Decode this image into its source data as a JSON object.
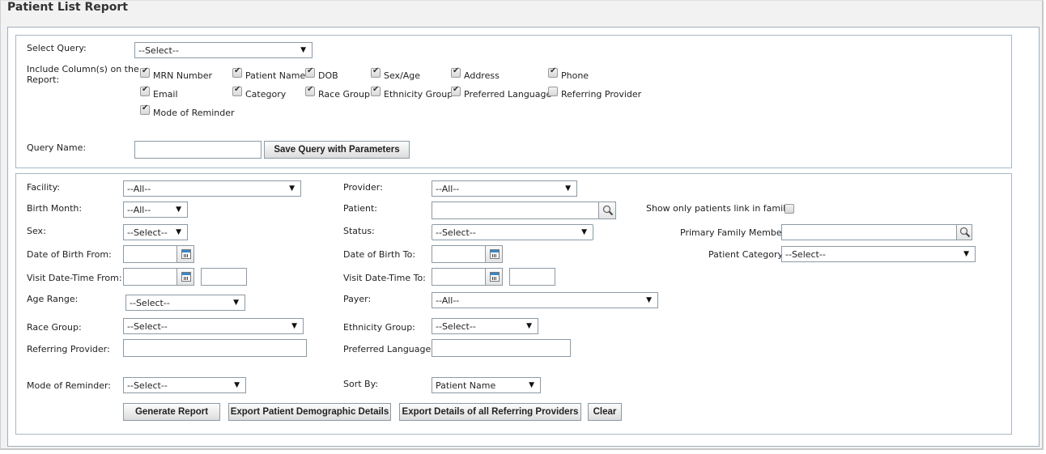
{
  "page": {
    "title": "Patient List Report"
  },
  "query": {
    "select_query_label": "Select Query:",
    "select_query_value": "--Select--",
    "include_columns_label_line1": "Include Column(s) on the",
    "include_columns_label_line2": "Report:",
    "columns": [
      {
        "label": "MRN Number",
        "checked": true
      },
      {
        "label": "Patient Name",
        "checked": true
      },
      {
        "label": "DOB",
        "checked": true
      },
      {
        "label": "Sex/Age",
        "checked": true
      },
      {
        "label": "Address",
        "checked": true
      },
      {
        "label": "Phone",
        "checked": true
      },
      {
        "label": "Email",
        "checked": true
      },
      {
        "label": "Category",
        "checked": true
      },
      {
        "label": "Race Group",
        "checked": true
      },
      {
        "label": "Ethnicity Group",
        "checked": true
      },
      {
        "label": "Preferred Language",
        "checked": true
      },
      {
        "label": "Referring Provider",
        "checked": false
      },
      {
        "label": "Mode of Reminder",
        "checked": true
      }
    ],
    "query_name_label": "Query Name:",
    "query_name_value": "",
    "save_button": "Save Query with Parameters"
  },
  "filters": {
    "facility": {
      "label": "Facility:",
      "value": "--All--"
    },
    "provider": {
      "label": "Provider:",
      "value": "--All--"
    },
    "birth_month": {
      "label": "Birth Month:",
      "value": "--All--"
    },
    "patient": {
      "label": "Patient:",
      "value": ""
    },
    "show_family": {
      "label": "Show only patients link in family:",
      "checked": false
    },
    "sex": {
      "label": "Sex:",
      "value": "--Select--"
    },
    "status": {
      "label": "Status:",
      "value": "--Select--"
    },
    "primary_family_member": {
      "label": "Primary Family Member:",
      "value": ""
    },
    "dob_from": {
      "label": "Date of Birth From:",
      "value": ""
    },
    "dob_to": {
      "label": "Date of Birth To:",
      "value": ""
    },
    "patient_category": {
      "label": "Patient Category:",
      "value": "--Select--"
    },
    "visit_from": {
      "label": "Visit Date-Time From:",
      "date": "",
      "time": ""
    },
    "visit_to": {
      "label": "Visit Date-Time To:",
      "date": "",
      "time": ""
    },
    "age_range": {
      "label": "Age Range:",
      "value": "--Select--"
    },
    "payer": {
      "label": "Payer:",
      "value": "--All--"
    },
    "race_group": {
      "label": "Race Group:",
      "value": "--Select--"
    },
    "ethnicity_group": {
      "label": "Ethnicity Group:",
      "value": "--Select--"
    },
    "referring_provider": {
      "label": "Referring Provider:",
      "value": ""
    },
    "preferred_language": {
      "label": "Preferred Language:",
      "value": ""
    },
    "mode_of_reminder": {
      "label": "Mode of Reminder:",
      "value": "--Select--"
    },
    "sort_by": {
      "label": "Sort By:",
      "value": "Patient Name"
    }
  },
  "actions": {
    "generate": "Generate Report",
    "export_demographic": "Export Patient Demographic Details",
    "export_referring": "Export Details of all Referring Providers",
    "clear": "Clear"
  },
  "icons": {
    "dropdown": "▼"
  }
}
